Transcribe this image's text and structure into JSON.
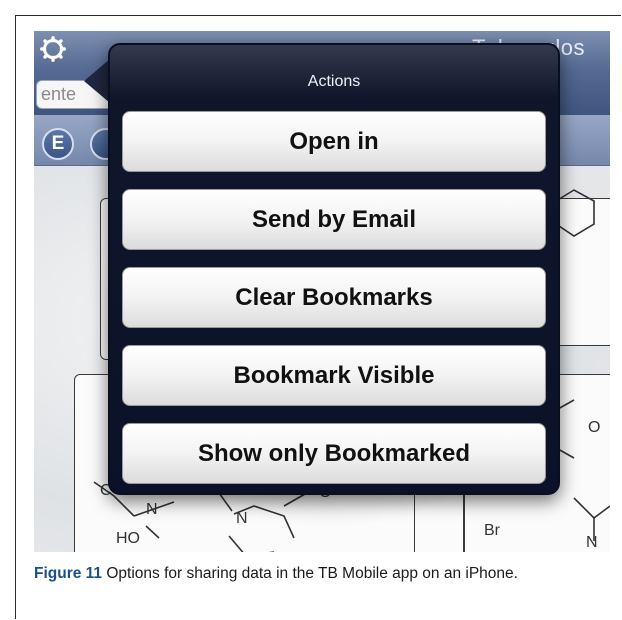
{
  "app": {
    "title": "Tuberculos",
    "search_placeholder": "ente"
  },
  "toolbar": {
    "buttons": [
      "E",
      ""
    ]
  },
  "popover": {
    "title": "Actions",
    "actions": [
      "Open in",
      "Send by Email",
      "Clear Bookmarks",
      "Bookmark Visible",
      "Show only Bookmarked"
    ]
  },
  "molecule_labels": {
    "n1": "N",
    "o1": "O",
    "n2": "N",
    "o2": "O",
    "n3": "N",
    "ho": "HO",
    "n4": "N",
    "o3": "O",
    "br": "Br",
    "n5": "N",
    "o4": "C"
  },
  "caption": {
    "label": "Figure 11",
    "text": " Options for sharing data in the TB Mobile app on an iPhone."
  },
  "colors": {
    "header_blue": "#566b93",
    "popover_dark": "#10162a",
    "caption_label": "#1b4f8a"
  }
}
